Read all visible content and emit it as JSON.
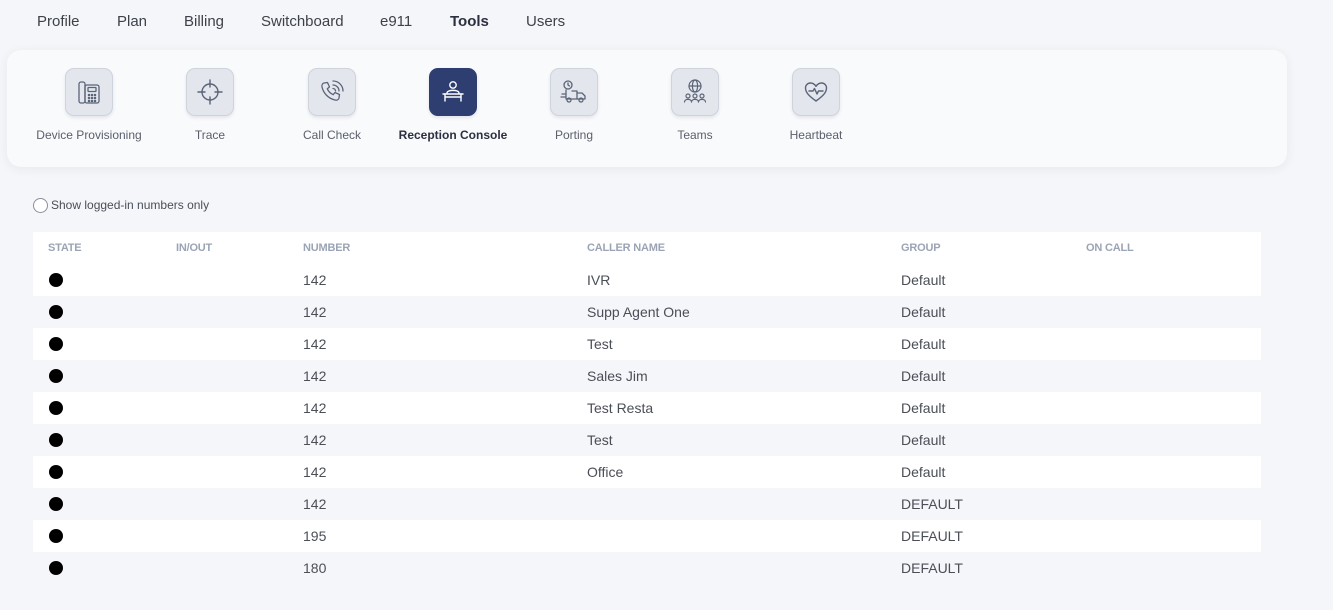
{
  "nav": {
    "items": [
      {
        "label": "Profile",
        "name": "nav-profile"
      },
      {
        "label": "Plan",
        "name": "nav-plan"
      },
      {
        "label": "Billing",
        "name": "nav-billing"
      },
      {
        "label": "Switchboard",
        "name": "nav-switchboard"
      },
      {
        "label": "e911",
        "name": "nav-e911"
      },
      {
        "label": "Tools",
        "name": "nav-tools",
        "active": true
      },
      {
        "label": "Users",
        "name": "nav-users"
      }
    ]
  },
  "tools": {
    "items": [
      {
        "label": "Device Provisioning",
        "icon": "desk-phone-icon"
      },
      {
        "label": "Trace",
        "icon": "crosshair-icon"
      },
      {
        "label": "Call Check",
        "icon": "phone-ringing-icon"
      },
      {
        "label": "Reception Console",
        "icon": "receptionist-icon",
        "active": true
      },
      {
        "label": "Porting",
        "icon": "moving-truck-icon"
      },
      {
        "label": "Teams",
        "icon": "globe-team-icon"
      },
      {
        "label": "Heartbeat",
        "icon": "heart-pulse-icon"
      }
    ]
  },
  "filter": {
    "label": "Show logged-in numbers only",
    "checked": false
  },
  "table": {
    "headers": {
      "state": "STATE",
      "inout": "IN/OUT",
      "number": "NUMBER",
      "caller": "CALLER NAME",
      "group": "GROUP",
      "oncall": "ON CALL"
    },
    "rows": [
      {
        "state": "offline",
        "inout": "",
        "number": "142",
        "caller": "IVR",
        "group": "Default",
        "oncall": ""
      },
      {
        "state": "offline",
        "inout": "",
        "number": "142",
        "caller": "Supp Agent One",
        "group": "Default",
        "oncall": ""
      },
      {
        "state": "offline",
        "inout": "",
        "number": "142",
        "caller": "Test",
        "group": "Default",
        "oncall": ""
      },
      {
        "state": "offline",
        "inout": "",
        "number": "142",
        "caller": "Sales Jim",
        "group": "Default",
        "oncall": ""
      },
      {
        "state": "offline",
        "inout": "",
        "number": "142",
        "caller": "Test Resta",
        "group": "Default",
        "oncall": ""
      },
      {
        "state": "offline",
        "inout": "",
        "number": "142",
        "caller": "Test",
        "group": "Default",
        "oncall": ""
      },
      {
        "state": "offline",
        "inout": "",
        "number": "142",
        "caller": "Office",
        "group": "Default",
        "oncall": ""
      },
      {
        "state": "offline",
        "inout": "",
        "number": "142",
        "caller": "",
        "group": "DEFAULT",
        "oncall": ""
      },
      {
        "state": "offline",
        "inout": "",
        "number": "195",
        "caller": "",
        "group": "DEFAULT",
        "oncall": ""
      },
      {
        "state": "offline",
        "inout": "",
        "number": "180",
        "caller": "",
        "group": "DEFAULT",
        "oncall": ""
      }
    ]
  },
  "colors": {
    "accent": "#2f3e70",
    "state_offline": "#000000"
  }
}
